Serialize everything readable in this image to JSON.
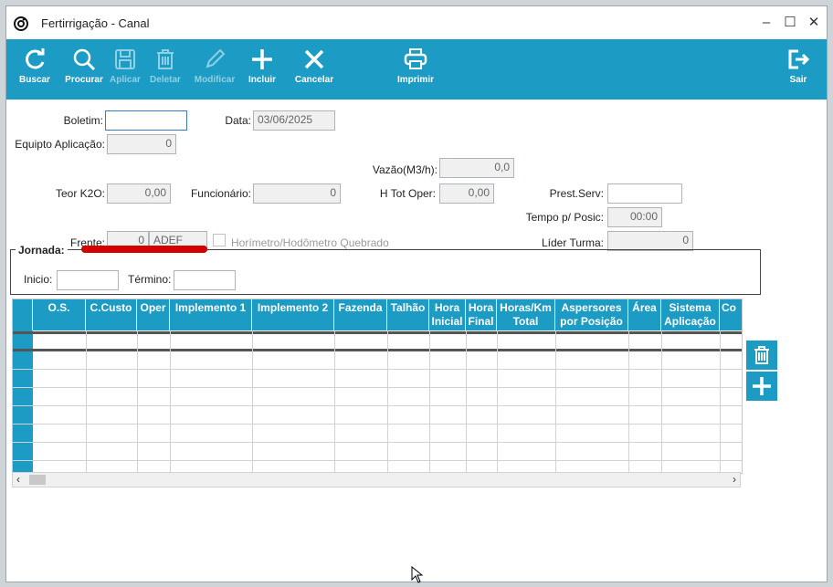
{
  "window": {
    "title": "Fertirrigação - Canal",
    "controls": [
      "minimize",
      "maximize",
      "close"
    ]
  },
  "toolbar": {
    "buttons": [
      {
        "label": "Buscar",
        "icon": "refresh-icon",
        "enabled": true
      },
      {
        "label": "Procurar",
        "icon": "search-icon",
        "enabled": true
      },
      {
        "label": "Aplicar",
        "icon": "save-icon",
        "enabled": false
      },
      {
        "label": "Deletar",
        "icon": "trash-icon",
        "enabled": false
      },
      {
        "label": "Modificar",
        "icon": "pencil-icon",
        "enabled": false
      },
      {
        "label": "Incluir",
        "icon": "plus-icon",
        "enabled": true
      },
      {
        "label": "Cancelar",
        "icon": "x-icon",
        "enabled": true
      },
      {
        "label": "Imprimir",
        "icon": "printer-icon",
        "enabled": true
      },
      {
        "label": "Sair",
        "icon": "exit-icon",
        "enabled": true
      }
    ]
  },
  "form": {
    "boletim": {
      "label": "Boletim:",
      "value": ""
    },
    "data": {
      "label": "Data:",
      "value": "03/06/2025"
    },
    "equipto": {
      "label": "Equipto Aplicação:",
      "value": "0"
    },
    "vazao": {
      "label": "Vazão(M3/h):",
      "value": "0,0"
    },
    "teor": {
      "label": "Teor K2O:",
      "value": "0,00"
    },
    "funcionario": {
      "label": "Funcionário:",
      "value": "0"
    },
    "htot": {
      "label": "H Tot Oper:",
      "value": "0,00"
    },
    "prest": {
      "label": "Prest.Serv:",
      "value": ""
    },
    "tempo": {
      "label": "Tempo p/ Posic:",
      "value": "00:00"
    },
    "frente": {
      "label": "Frente:",
      "value": "0",
      "name": "ADEF"
    },
    "horimetro": {
      "label": "Horímetro/Hodômetro Quebrado",
      "checked": false
    },
    "lider": {
      "label": "Líder Turma:",
      "value": "0"
    }
  },
  "jornada": {
    "title": "Jornada:",
    "inicio": {
      "label": "Inicio:",
      "value": ""
    },
    "termino": {
      "label": "Término:",
      "value": ""
    }
  },
  "grid": {
    "columns": [
      {
        "l1": "O.S.",
        "l2": ""
      },
      {
        "l1": "C.Custo",
        "l2": ""
      },
      {
        "l1": "Oper",
        "l2": ""
      },
      {
        "l1": "Implemento 1",
        "l2": ""
      },
      {
        "l1": "Implemento 2",
        "l2": ""
      },
      {
        "l1": "Fazenda",
        "l2": ""
      },
      {
        "l1": "Talhão",
        "l2": ""
      },
      {
        "l1": "Hora",
        "l2": "Inicial"
      },
      {
        "l1": "Hora",
        "l2": "Final"
      },
      {
        "l1": "Horas/Km",
        "l2": "Total"
      },
      {
        "l1": "Aspersores",
        "l2": "por Posição"
      },
      {
        "l1": "Área",
        "l2": ""
      },
      {
        "l1": "Sistema",
        "l2": "Aplicação"
      },
      {
        "l1": "Co",
        "l2": ""
      }
    ]
  },
  "colors": {
    "accent": "#1c9cc4",
    "warning_bar": "#d40000"
  }
}
